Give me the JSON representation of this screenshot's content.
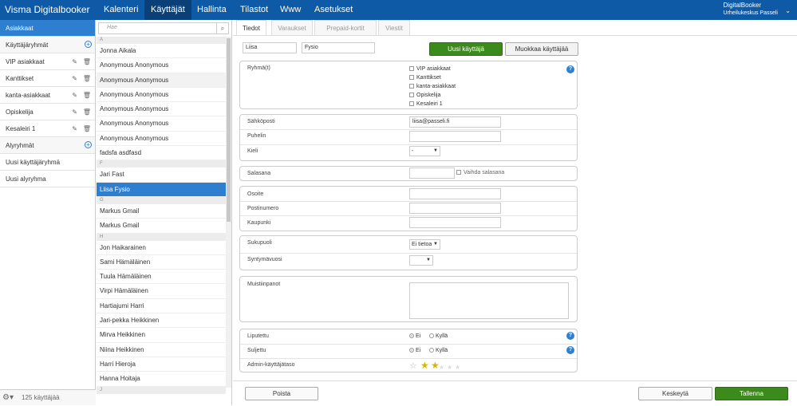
{
  "app": {
    "brand": "Visma Digitalbooker",
    "user_name": "DigitalBooker",
    "user_org": "Urheilukeskus Passeli"
  },
  "nav": [
    {
      "label": "Kalenteri"
    },
    {
      "label": "Käyttäjät"
    },
    {
      "label": "Hallinta"
    },
    {
      "label": "Tilastot"
    },
    {
      "label": "Www"
    },
    {
      "label": "Asetukset"
    }
  ],
  "sidebar": {
    "items": [
      {
        "label": "Asiakkaat"
      },
      {
        "label": "Käyttäjäryhmät"
      },
      {
        "label": "VIP asiakkaat"
      },
      {
        "label": "Kanttikset"
      },
      {
        "label": "kanta-asiakkaat"
      },
      {
        "label": "Opiskelija"
      },
      {
        "label": "Kesaleiri 1"
      },
      {
        "label": "Alyryhmät"
      },
      {
        "label": "Uusi käyttäjäryhmä"
      },
      {
        "label": "Uusi alyryhma"
      }
    ],
    "count": "125 käyttäjää"
  },
  "search": {
    "placeholder": "Hae"
  },
  "userlist": {
    "h_a": "A",
    "h_f": "F",
    "h_g": "G",
    "h_h": "H",
    "h_j": "J",
    "a": [
      "Jonna Aikala",
      "Anonymous Anonymous",
      "Anonymous Anonymous",
      "Anonymous Anonymous",
      "Anonymous Anonymous",
      "Anonymous Anonymous",
      "Anonymous Anonymous",
      "fadsfa asdfasd"
    ],
    "f": [
      "Jari Fast",
      "Liisa Fysio"
    ],
    "g": [
      "Markus Gmail",
      "Markus Gmail"
    ],
    "h": [
      "Jon Haikarainen",
      "Sami Hämäläinen",
      "Tuula Hämäläinen",
      "Virpi Hämäläinen",
      "Hartiajumi Harri",
      "Jari-pekka Heikkinen",
      "Mirva Heikkinen",
      "Niina Heikkinen",
      "Harri Hieroja",
      "Hanna Hoitaja"
    ]
  },
  "tabs": [
    {
      "label": "Tiedot"
    },
    {
      "label": "Varaukset"
    },
    {
      "label": "Prepaid-kortit"
    },
    {
      "label": "Viestit"
    }
  ],
  "form": {
    "first_name": "Liisa",
    "last_name": "Fysio",
    "new_user_btn": "Uusi käyttäjä",
    "edit_user_btn": "Muokkaa käyttäjää",
    "groups_label": "Ryhmä(t)",
    "groups": [
      "VIP asiakkaat",
      "Kanttikset",
      "kanta-asiakkaat",
      "Opiskelija",
      "Kesaleiri 1"
    ],
    "email_label": "Sähköposti",
    "email_value": "liisa@passeli.fi",
    "phone_label": "Puhelin",
    "lang_label": "Kieli",
    "lang_value": "-",
    "password_label": "Salasana",
    "change_password": "Vaihda salasana",
    "address_label": "Osoite",
    "zip_label": "Postinumero",
    "city_label": "Kaupunki",
    "gender_label": "Sukupuoli",
    "gender_value": "Ei tietoa",
    "birthyear_label": "Syntymävuosi",
    "notes_label": "Muistiinpanot",
    "flagged_label": "Liputettu",
    "closed_label": "Suljettu",
    "no": "Ei",
    "yes": "Kyllä",
    "admin_label": "Admin-käyttäjätaso",
    "admin_level": 2,
    "admin_max": 5
  },
  "footer": {
    "delete": "Poista",
    "cancel": "Keskeytä",
    "save": "Tallenna"
  },
  "colors": {
    "nav_bg": "#0f5aa6",
    "accent": "#2f7fd1",
    "save_green": "#3d8a1c"
  }
}
